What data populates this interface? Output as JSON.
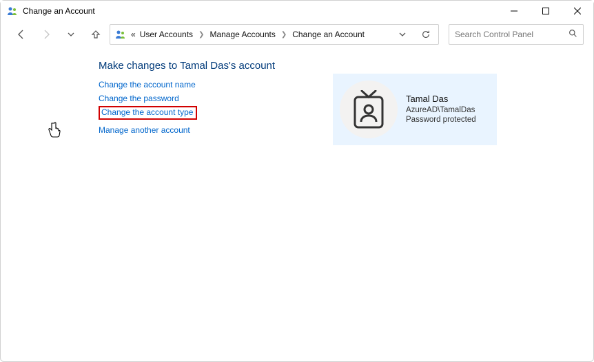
{
  "window": {
    "title": "Change an Account"
  },
  "breadcrumbs": {
    "b0": "User Accounts",
    "b1": "Manage Accounts",
    "b2": "Change an Account"
  },
  "search": {
    "placeholder": "Search Control Panel"
  },
  "page": {
    "heading": "Make changes to Tamal Das's account",
    "links": {
      "change_name": "Change the account name",
      "change_password": "Change the password",
      "change_type": "Change the account type",
      "manage_other": "Manage another account"
    }
  },
  "account": {
    "display_name": "Tamal Das",
    "identity": "AzureAD\\TamalDas",
    "status": "Password protected"
  },
  "icons": {
    "people": "people-icon",
    "back": "back-icon",
    "forward": "forward-icon",
    "chevdown": "chevron-down-icon",
    "up": "up-icon",
    "refresh": "refresh-icon",
    "search": "search-icon",
    "min": "minimize-icon",
    "max": "maximize-icon",
    "close": "close-icon",
    "id": "id-badge-icon"
  }
}
